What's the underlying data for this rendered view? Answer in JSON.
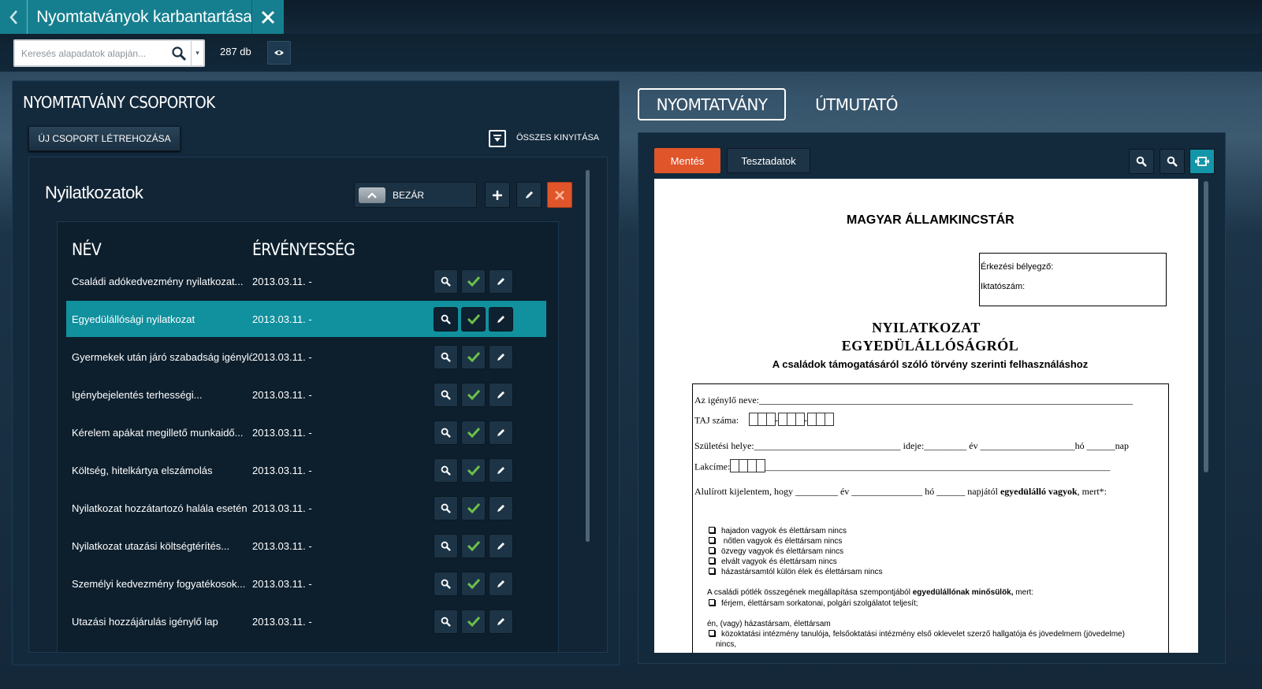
{
  "window": {
    "title": "Nyomtatványok karbantartása"
  },
  "search": {
    "placeholder": "Keresés alapadatok alapján..."
  },
  "record_count": "287 db",
  "left_panel": {
    "heading": "NYOMTATVÁNY CSOPORTOK",
    "new_group_label": "ÚJ CSOPORT LÉTREHOZÁSA",
    "expand_all_label": "ÖSSZES KINYITÁSA"
  },
  "group": {
    "title": "Nyilatkozatok",
    "collapse_label": "BEZÁR",
    "columns": {
      "name": "NÉV",
      "validity": "ÉRVÉNYESSÉG"
    },
    "rows": [
      {
        "name": "Családi adókedvezmény nyilatkozat...",
        "validity": "2013.03.11. -"
      },
      {
        "name": "Egyedülállósági nyilatkozat",
        "validity": "2013.03.11. -"
      },
      {
        "name": "Gyermekek után járó szabadság igénylő",
        "validity": "2013.03.11. -"
      },
      {
        "name": "Igénybejelentés terhességi...",
        "validity": "2013.03.11. -"
      },
      {
        "name": "Kérelem apákat megillető munkaidő...",
        "validity": "2013.03.11. -"
      },
      {
        "name": "Költség, hitelkártya elszámolás",
        "validity": "2013.03.11. -"
      },
      {
        "name": "Nyilatkozat hozzátartozó halála esetén",
        "validity": "2013.03.11. -"
      },
      {
        "name": "Nyilatkozat utazási költségtérítés...",
        "validity": "2013.03.11. -"
      },
      {
        "name": "Személyi kedvezmény fogyatékosok...",
        "validity": "2013.03.11. -"
      },
      {
        "name": "Utazási hozzájárulás igénylő lap",
        "validity": "2013.03.11. -"
      }
    ],
    "selected_row": "Egyedülállósági nyilatkozat"
  },
  "right_panel": {
    "tabs": [
      "NYOMTATVÁNY",
      "ÚTMUTATÓ"
    ],
    "active_tab": "NYOMTATVÁNY",
    "save_label": "Mentés",
    "test_data_label": "Tesztadatok"
  },
  "document": {
    "header": "MAGYAR ÁLLAMKINCSTÁR",
    "stamp_label": "Érkezési bélyegző:",
    "filing_label": "Iktatószám:",
    "title_line1": "NYILATKOZAT",
    "title_line2": "EGYEDÜLÁLLÓSÁGRÓL",
    "subtitle": "A családok támogatásáról szóló törvény szerinti felhasználáshoz",
    "name_line": "Az igénylő neve:_______________________________________________________________________________",
    "taj_label": "TAJ száma:",
    "birth_line": "Születési helye:_______________________________ ideje:_________ év ____________________hó ______nap",
    "address_label": "Lakcíme:",
    "address_line": "_________________________________________________________________________",
    "declaration_pre": "Alulírott kijelentem, hogy _________ év _______________ hó ______ napjától ",
    "declaration_bold": "egyedülálló vagyok",
    "declaration_post": ", mert*:",
    "options": [
      "hajadon vagyok és élettársam nincs",
      " nőtlen vagyok és élettársam nincs",
      "özvegy vagyok és élettársam nincs",
      "elvált vagyok és élettársam nincs",
      "házastársamtól külön élek és élettársam nincs"
    ],
    "family_pre": "A családi pótlék összegének megállapítása szempontjából ",
    "family_bold": "egyedülállónak minősülök,",
    "family_post": " mert:",
    "family_option": "férjem, élettársam sorkatonai, polgári szolgálatot teljesít;",
    "or_line": "én, (vagy) házastársam, élettársam",
    "edu_line1": "közoktatási intézmény tanulója, felsőoktatási intézmény első oklevelet szerző hallgatója és jövedelmem (jövedelme)",
    "edu_line2": "nincs,"
  }
}
